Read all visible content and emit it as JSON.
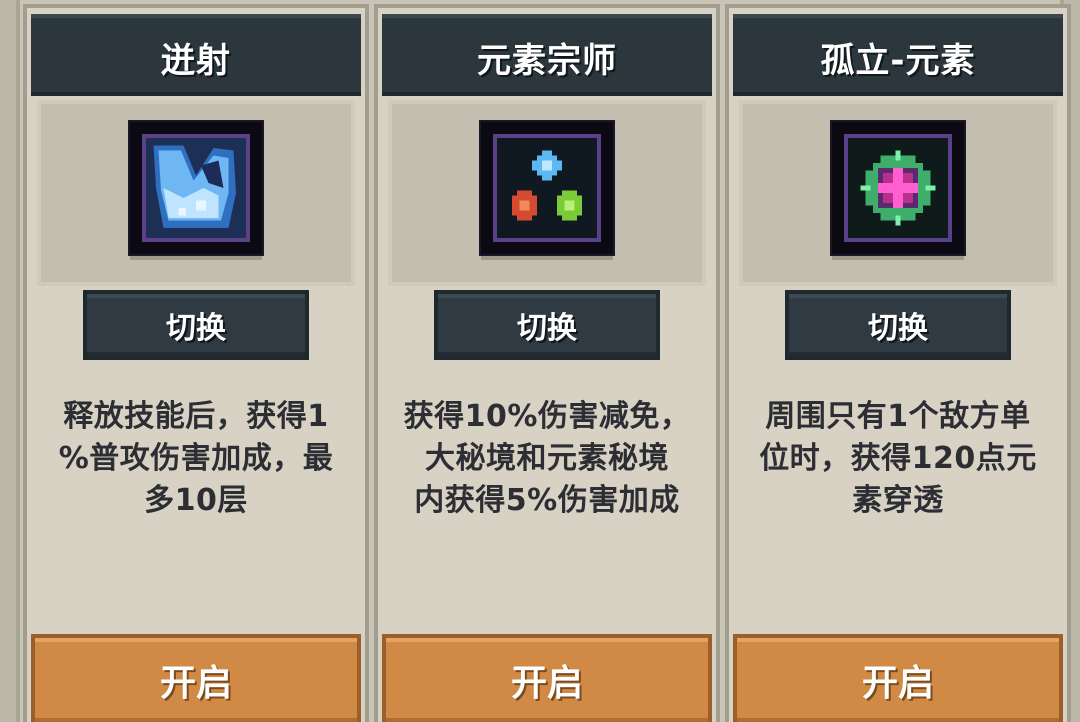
{
  "cards": [
    {
      "title": "迸射",
      "icon": "burst-icon",
      "switch_label": "切换",
      "description_lines": [
        "释放技能后，获得1",
        "%普攻伤害加成，最",
        "多10层"
      ],
      "open_label": "开启"
    },
    {
      "title": "元素宗师",
      "icon": "elemental-master-icon",
      "switch_label": "切换",
      "description_lines": [
        "获得10%伤害减免，",
        "大秘境和元素秘境",
        "内获得5%伤害加成"
      ],
      "open_label": "开启"
    },
    {
      "title": "孤立-元素",
      "icon": "isolation-element-icon",
      "switch_label": "切换",
      "description_lines": [
        "周围只有1个敌方单",
        "位时，获得120点元",
        "素穿透"
      ],
      "open_label": "开启"
    }
  ],
  "colors": {
    "header_bg": "#2b363d",
    "switch_bg": "#2f3a42",
    "open_bg": "#d18a45",
    "card_bg": "#d7d2c4",
    "icon_border": "#5a3f89"
  }
}
